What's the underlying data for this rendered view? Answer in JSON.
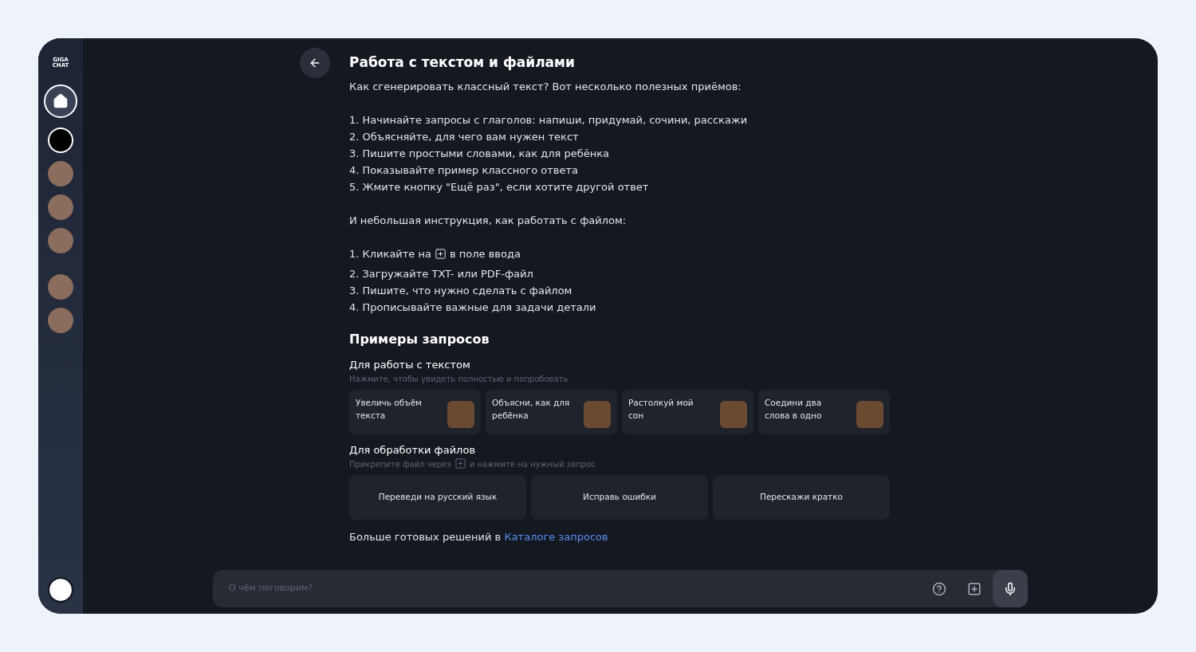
{
  "sidebar": {
    "logo_lines": [
      "GIGA",
      "CHAT"
    ],
    "home": {
      "selected": true
    },
    "avatars": [
      {
        "kind": "brand"
      },
      {
        "kind": "photo"
      },
      {
        "kind": "photo"
      },
      {
        "kind": "photo"
      },
      {
        "kind": "gap"
      },
      {
        "kind": "photo"
      },
      {
        "kind": "photo"
      }
    ]
  },
  "article": {
    "title": "Работа с текстом и файлами",
    "intro": "Как сгенерировать классный текст? Вот несколько полезных приёмов:",
    "tips": [
      "1. Начинайте запросы с глаголов: напиши, придумай, сочини, расскажи",
      "2. Объясняйте, для чего вам нужен текст",
      "3. Пишите простыми словами, как для ребёнка",
      "4. Показывайте пример классного ответа",
      "5. Жмите кнопку \"Ещё раз\", если хотите другой ответ"
    ],
    "file_intro": "И небольшая инструкция, как работать с файлом:",
    "file_steps": [
      {
        "before": "1. Кликайте на",
        "after": "в поле ввода",
        "icon": true
      },
      {
        "before": "2. Загружайте TXT- или PDF-файл",
        "icon": false
      },
      {
        "before": "3. Пишите, что нужно сделать с файлом",
        "icon": false
      },
      {
        "before": "4. Прописывайте важные для задачи детали",
        "icon": false
      }
    ]
  },
  "examples": {
    "title": "Примеры запросов",
    "text_section": {
      "title": "Для работы с текстом",
      "hint": "Нажмите, чтобы увидеть полностью и попробовать",
      "cards": [
        {
          "label": "Увеличь объём текста"
        },
        {
          "label": "Объясни, как для ребёнка"
        },
        {
          "label": "Растолкуй мой сон"
        },
        {
          "label": "Соедини два слова в одно"
        }
      ]
    },
    "file_section": {
      "title": "Для обработки файлов",
      "hint_before": "Прикрепите файл через",
      "hint_after": "и нажмите на нужный запрос",
      "buttons": [
        "Переведи на русский язык",
        "Исправь ошибки",
        "Перескажи кратко"
      ]
    },
    "more_text": "Больше готовых решений в",
    "more_link": "Каталоге запросов"
  },
  "input": {
    "placeholder": "О чём поговорим?"
  }
}
